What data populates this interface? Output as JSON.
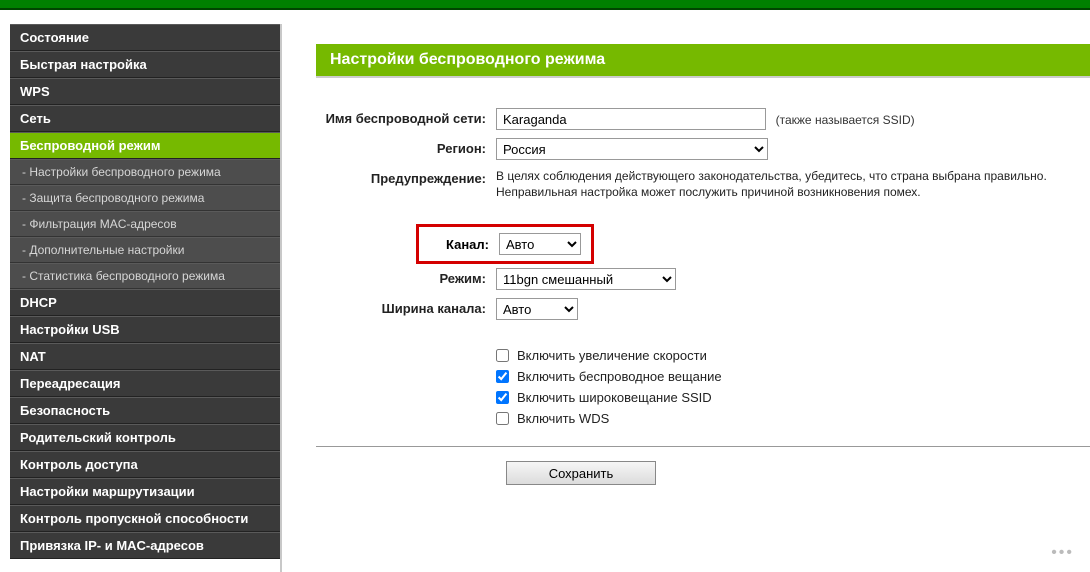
{
  "sidebar": {
    "items": [
      {
        "label": "Состояние",
        "type": "item"
      },
      {
        "label": "Быстрая настройка",
        "type": "item"
      },
      {
        "label": "WPS",
        "type": "item"
      },
      {
        "label": "Сеть",
        "type": "item"
      },
      {
        "label": "Беспроводной режим",
        "type": "item",
        "active": true
      },
      {
        "label": "- Настройки беспроводного режима",
        "type": "sub"
      },
      {
        "label": "- Защита беспроводного режима",
        "type": "sub"
      },
      {
        "label": "- Фильтрация MAC-адресов",
        "type": "sub"
      },
      {
        "label": "- Дополнительные настройки",
        "type": "sub"
      },
      {
        "label": "- Статистика беспроводного режима",
        "type": "sub"
      },
      {
        "label": "DHCP",
        "type": "item"
      },
      {
        "label": "Настройки USB",
        "type": "item"
      },
      {
        "label": "NAT",
        "type": "item"
      },
      {
        "label": "Переадресация",
        "type": "item"
      },
      {
        "label": "Безопасность",
        "type": "item"
      },
      {
        "label": "Родительский контроль",
        "type": "item"
      },
      {
        "label": "Контроль доступа",
        "type": "item"
      },
      {
        "label": "Настройки маршрутизации",
        "type": "item"
      },
      {
        "label": "Контроль пропускной способности",
        "type": "item"
      },
      {
        "label": "Привязка IP- и MAC-адресов",
        "type": "item"
      }
    ]
  },
  "page": {
    "title": "Настройки беспроводного режима",
    "ssid_label": "Имя беспроводной сети:",
    "ssid_value": "Karaganda",
    "ssid_hint": "(также называется SSID)",
    "region_label": "Регион:",
    "region_value": "Россия",
    "warning_label": "Предупреждение:",
    "warning_text": "В целях соблюдения действующего законодательства, убедитесь, что страна выбрана правильно. Неправильная настройка может послужить причиной возникновения помех.",
    "channel_label": "Канал:",
    "channel_value": "Авто",
    "mode_label": "Режим:",
    "mode_value": "11bgn смешанный",
    "width_label": "Ширина канала:",
    "width_value": "Авто",
    "chk_speed": "Включить увеличение скорости",
    "chk_broadcast": "Включить беспроводное вещание",
    "chk_ssid": "Включить широковещание SSID",
    "chk_wds": "Включить WDS",
    "save": "Сохранить"
  }
}
